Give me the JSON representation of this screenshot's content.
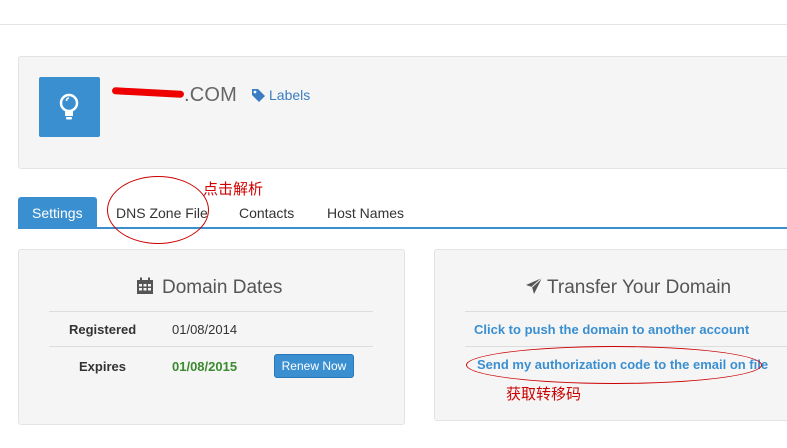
{
  "domain": {
    "name": ".COM",
    "labels_link": "Labels",
    "icon": "lightbulb-icon",
    "icon_bg": "#3a8fd1"
  },
  "annotations": {
    "dns_hint": "点击解析",
    "auth_hint": "获取转移码",
    "color": "#cc0000"
  },
  "tabs": [
    {
      "label": "Settings",
      "active": true
    },
    {
      "label": "DNS Zone File",
      "active": false
    },
    {
      "label": "Contacts",
      "active": false
    },
    {
      "label": "Host Names",
      "active": false
    }
  ],
  "dates": {
    "title": "Domain Dates",
    "icon": "calendar-icon",
    "rows": [
      {
        "label": "Registered",
        "value": "01/08/2014"
      },
      {
        "label": "Expires",
        "value": "01/08/2015"
      }
    ],
    "renew_label": "Renew Now"
  },
  "transfer": {
    "title": "Transfer Your Domain",
    "icon": "paper-plane-icon",
    "links": [
      "Click to push the domain to another account",
      "Send my authorization code to the email on file"
    ]
  },
  "colors": {
    "accent": "#3a8fd1",
    "expires_value": "#3a8a2e"
  }
}
